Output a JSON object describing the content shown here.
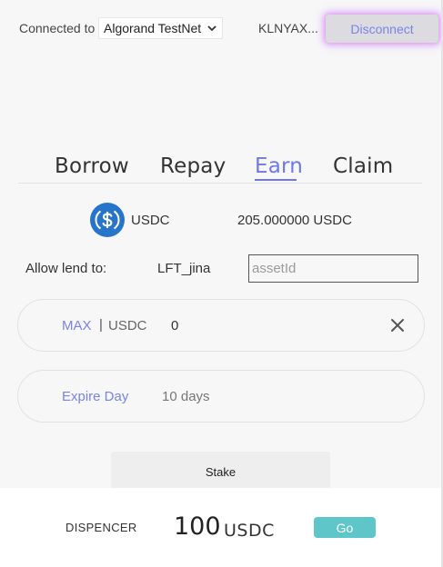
{
  "header": {
    "connected_label": "Connected to",
    "network": "Algorand TestNet",
    "account": "KLNYAX...",
    "disconnect_label": "Disconnect"
  },
  "tabs": [
    {
      "label": "Borrow",
      "active": false
    },
    {
      "label": "Repay",
      "active": false
    },
    {
      "label": "Earn",
      "active": true
    },
    {
      "label": "Claim",
      "active": false
    }
  ],
  "asset": {
    "icon": "usdc-coin-icon",
    "name": "USDC",
    "balance": "205.000000 USDC"
  },
  "allow": {
    "label": "Allow lend to:",
    "asset": "LFT_jina",
    "input_placeholder": "assetId",
    "input_value": ""
  },
  "amount": {
    "max_label": "MAX",
    "separator": "|",
    "unit": "USDC",
    "value": "0"
  },
  "expire": {
    "label": "Expire Day",
    "value": "10 days"
  },
  "stake_label": "Stake",
  "dispencer": {
    "label": "DISPENCER",
    "amount": "100",
    "unit": "USDC",
    "go_label": "Go"
  },
  "colors": {
    "accent": "#6e78e6",
    "link": "#7a83e8",
    "usdc_blue": "#2775ca",
    "go_button": "#5ec6c9",
    "disconnect_glow": "#c478ff"
  }
}
